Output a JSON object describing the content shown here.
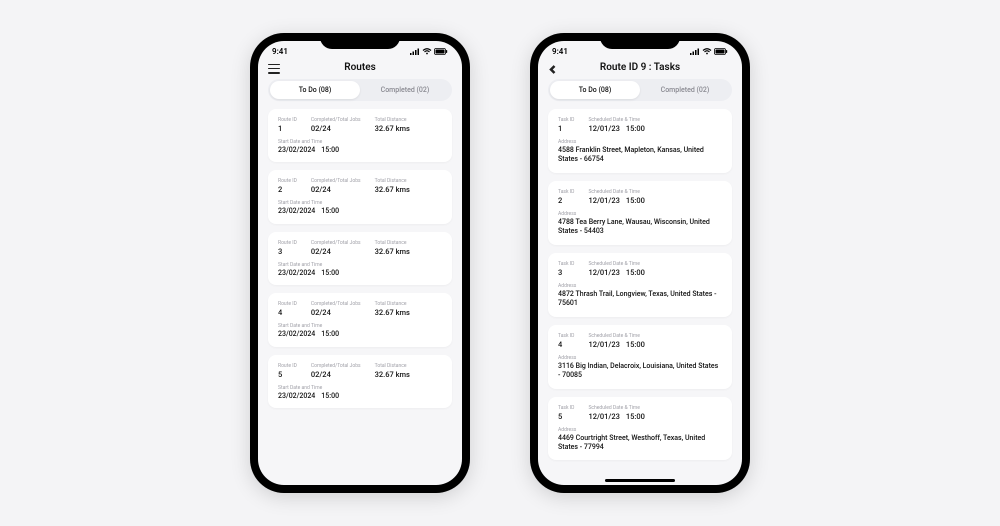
{
  "status": {
    "time": "9:41"
  },
  "labels": {
    "routeId": "Route ID",
    "completedTotal": "Completed/Total Jobs",
    "totalDistance": "Total Distance",
    "startDateTime": "Start Date and Time",
    "taskId": "Task ID",
    "scheduledDateTime": "Scheduled Date & Time",
    "address": "Address"
  },
  "left": {
    "title": "Routes",
    "tabs": {
      "active": "To Do (08)",
      "inactive": "Completed (02)"
    },
    "routes": [
      {
        "id": "1",
        "ct": "02/24",
        "dist": "32.67 kms",
        "date": "23/02/2024",
        "time": "15:00"
      },
      {
        "id": "2",
        "ct": "02/24",
        "dist": "32.67 kms",
        "date": "23/02/2024",
        "time": "15:00"
      },
      {
        "id": "3",
        "ct": "02/24",
        "dist": "32.67 kms",
        "date": "23/02/2024",
        "time": "15:00"
      },
      {
        "id": "4",
        "ct": "02/24",
        "dist": "32.67 kms",
        "date": "23/02/2024",
        "time": "15:00"
      },
      {
        "id": "5",
        "ct": "02/24",
        "dist": "32.67 kms",
        "date": "23/02/2024",
        "time": "15:00"
      }
    ]
  },
  "right": {
    "title": "Route ID 9 : Tasks",
    "tabs": {
      "active": "To Do (08)",
      "inactive": "Completed (02)"
    },
    "tasks": [
      {
        "id": "1",
        "date": "12/01/23",
        "time": "15:00",
        "addr": "4588 Franklin Street, Mapleton, Kansas, United States - 66754"
      },
      {
        "id": "2",
        "date": "12/01/23",
        "time": "15:00",
        "addr": "4788 Tea Berry Lane, Wausau, Wisconsin, United States - 54403"
      },
      {
        "id": "3",
        "date": "12/01/23",
        "time": "15:00",
        "addr": "4872 Thrash Trail, Longview, Texas,  United States - 75601"
      },
      {
        "id": "4",
        "date": "12/01/23",
        "time": "15:00",
        "addr": "3116 Big Indian, Delacroix,  Louisiana, United States - 70085"
      },
      {
        "id": "5",
        "date": "12/01/23",
        "time": "15:00",
        "addr": "4469 Courtright Street, Westhoff, Texas,  United States - 77994"
      }
    ]
  }
}
